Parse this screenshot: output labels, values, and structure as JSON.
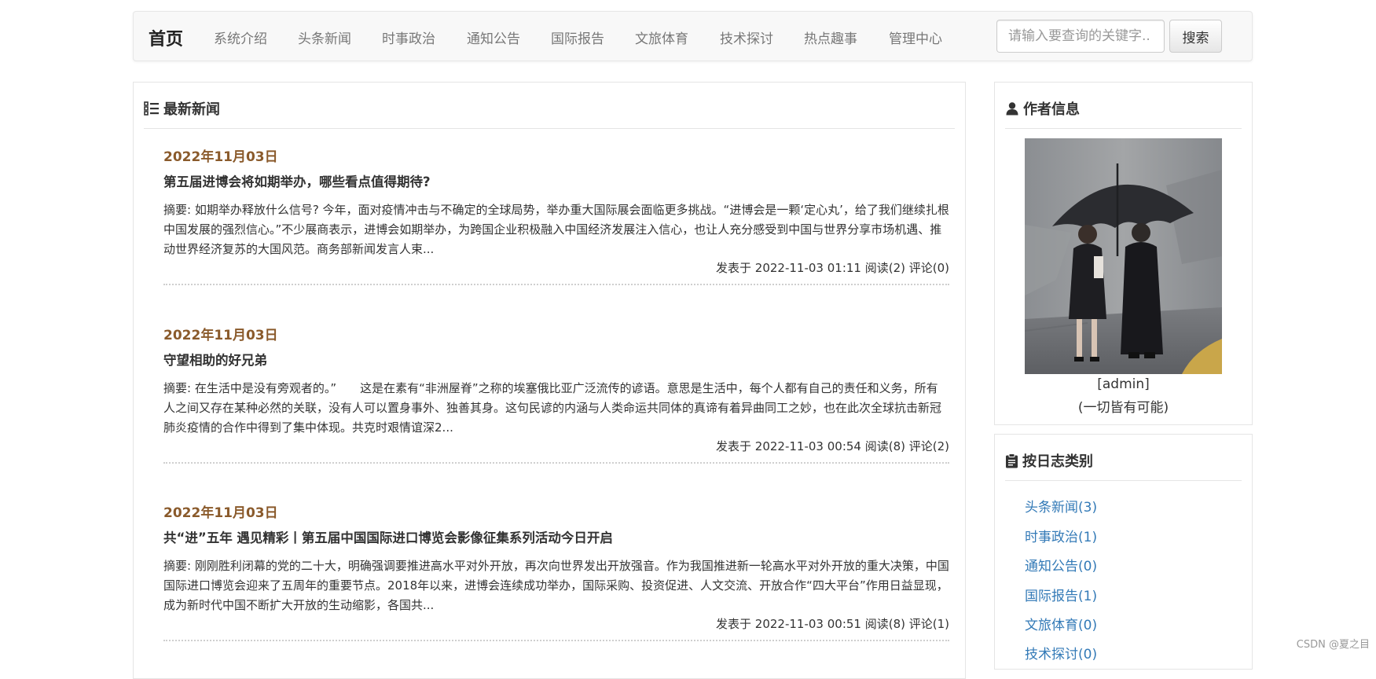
{
  "nav": {
    "brand": "首页",
    "items": [
      "系统介绍",
      "头条新闻",
      "时事政治",
      "通知公告",
      "国际报告",
      "文旅体育",
      "技术探讨",
      "热点趣事",
      "管理中心"
    ],
    "search_placeholder": "请输入要查询的关键字..",
    "search_button": "搜索"
  },
  "main": {
    "title": "最新新闻",
    "title_icon": "list-icon",
    "news": [
      {
        "date": "2022年11月03日",
        "title": "第五届进博会将如期举办，哪些看点值得期待?",
        "summary": "摘要: 如期举办释放什么信号? 今年，面对疫情冲击与不确定的全球局势，举办重大国际展会面临更多挑战。“进博会是一颗‘定心丸’，给了我们继续扎根中国发展的强烈信心。”不少展商表示，进博会如期举办，为跨国企业积极融入中国经济发展注入信心，也让人充分感受到中国与世界分享市场机遇、推动世界经济复苏的大国风范。商务部新闻发言人束...",
        "meta": "发表于 2022-11-03 01:11 阅读(2) 评论(0)"
      },
      {
        "date": "2022年11月03日",
        "title": "守望相助的好兄弟",
        "summary": "摘要: 在生活中是没有旁观者的。”　　这是在素有“非洲屋脊”之称的埃塞俄比亚广泛流传的谚语。意思是生活中，每个人都有自己的责任和义务，所有人之间又存在某种必然的关联，没有人可以置身事外、独善其身。这句民谚的内涵与人类命运共同体的真谛有着异曲同工之妙，也在此次全球抗击新冠肺炎疫情的合作中得到了集中体现。共克时艰情谊深2...",
        "meta": "发表于 2022-11-03 00:54 阅读(8) 评论(2)"
      },
      {
        "date": "2022年11月03日",
        "title": "共“进”五年 遇见精彩丨第五届中国国际进口博览会影像征集系列活动今日开启",
        "summary": "摘要: 刚刚胜利闭幕的党的二十大，明确强调要推进高水平对外开放，再次向世界发出开放强音。作为我国推进新一轮高水平对外开放的重大决策，中国国际进口博览会迎来了五周年的重要节点。2018年以来，进博会连续成功举办，国际采购、投资促进、人文交流、开放合作“四大平台”作用日益显现，成为新时代中国不断扩大开放的生动缩影，各国共...",
        "meta": "发表于 2022-11-03 00:51 阅读(8) 评论(1)"
      }
    ]
  },
  "author": {
    "title": "作者信息",
    "title_icon": "user-icon",
    "name": "[admin]",
    "motto": "(一切皆有可能)"
  },
  "categories": {
    "title": "按日志类别",
    "title_icon": "clipboard-icon",
    "items": [
      "头条新闻(3)",
      "时事政治(1)",
      "通知公告(0)",
      "国际报告(1)",
      "文旅体育(0)",
      "技术探讨(0)"
    ]
  },
  "watermark": "CSDN @夏之目",
  "colors": {
    "date": "#8a5a2b",
    "link": "#337ab7",
    "navbar_bg": "#f8f8f8"
  }
}
